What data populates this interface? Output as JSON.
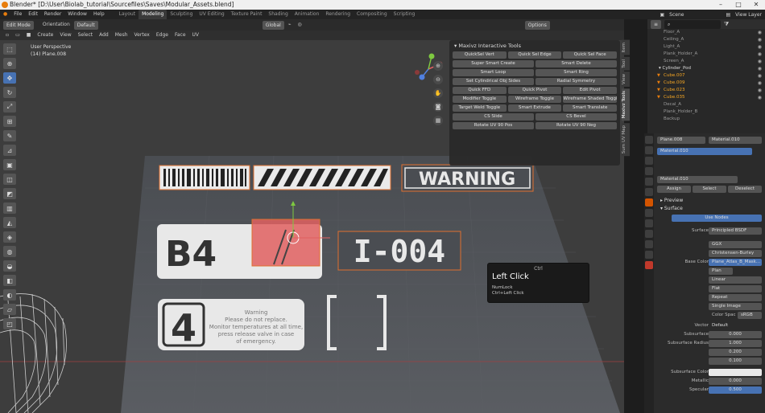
{
  "titlebar": {
    "title": "Blender* [D:\\User\\Biolab_tutorial\\Sourcefiles\\Saves\\Modular_Assets.blend]"
  },
  "menu": [
    "File",
    "Edit",
    "Render",
    "Window",
    "Help"
  ],
  "workspaces": [
    "Layout",
    "Modeling",
    "Sculpting",
    "UV Editing",
    "Texture Paint",
    "Shading",
    "Animation",
    "Rendering",
    "Compositing",
    "Scripting"
  ],
  "top_right": {
    "scene": "Scene",
    "view_layer": "View Layer"
  },
  "viewport_header": {
    "mode": "Edit Mode",
    "orientation": "Orientation",
    "orientation_value": "Default",
    "transform_space": "Global",
    "options": "Options",
    "menus": [
      "View",
      "Select",
      "Add",
      "Mesh",
      "Vertex",
      "Edge",
      "Face",
      "UV"
    ],
    "create": "Create"
  },
  "viewport_info": {
    "perspective": "User Perspective",
    "object": "(14) Plane.008"
  },
  "tools_panel": {
    "title": "Maxivz Interactive Tools",
    "rows": [
      [
        "QuickSel Vert",
        "Quick Sel Edge",
        "Quick Sel Face"
      ],
      [
        "Super Smart Create",
        "Smart Delete"
      ],
      [
        "Smart Loop",
        "Smart Ring"
      ],
      [
        "Set Cylindrical Obj Sides",
        "Radial Symmetry"
      ],
      [
        "Quick FFD",
        "Quick Pivot",
        "Edit Pivot"
      ],
      [
        "Modifier Toggle",
        "Wireframe Toggle",
        "Wireframe Shaded Toggle"
      ],
      [
        "Target Weld Toggle",
        "Smart Extrude",
        "Smart Translate"
      ],
      [
        "CS Slide",
        "CS Bevel"
      ],
      [
        "Rotate UV 90 Pos",
        "Rotate UV 90 Neg"
      ]
    ]
  },
  "side_tabs": [
    "Item",
    "Tool",
    "View",
    "Maxivz Tools",
    "Sum UV Map"
  ],
  "scene_labels": {
    "warning": "WARNING",
    "b4": "B4",
    "id_code": "I-004",
    "number": "4",
    "warning_text": "Warning\nPlease do not replace. Monitor temperatures at all time, press release valve in case of emergency.",
    "brackets": "[   ]"
  },
  "tooltip": {
    "key": "Ctrl",
    "action": "Left Click",
    "line1": "NumLock",
    "line2": "Ctrl+Left Click"
  },
  "outliner": {
    "items": [
      {
        "name": "Floor_A",
        "type": "obj"
      },
      {
        "name": "Ceiling_A",
        "type": "obj"
      },
      {
        "name": "Light_A",
        "type": "obj"
      },
      {
        "name": "Plank_Holder_A",
        "type": "obj"
      },
      {
        "name": "Screen_A",
        "type": "obj"
      },
      {
        "name": "Cylinder_Pod",
        "type": "collection"
      },
      {
        "name": "Cube.007",
        "type": "sel"
      },
      {
        "name": "Cube.009",
        "type": "sel"
      },
      {
        "name": "Cube.023",
        "type": "sel"
      },
      {
        "name": "Cube.035",
        "type": "sel"
      },
      {
        "name": "Decal_A",
        "type": "obj"
      },
      {
        "name": "Plank_Holder_B",
        "type": "obj"
      },
      {
        "name": "Backup",
        "type": "obj"
      }
    ]
  },
  "properties": {
    "object": "Plane.008",
    "material_tab": "Material.010",
    "slot": "Material.010",
    "material_name": "Material.010",
    "buttons": [
      "Assign",
      "Select",
      "Deselect"
    ],
    "sections": {
      "preview": "Preview",
      "surface": "Surface"
    },
    "use_nodes": "Use Nodes",
    "surface_label": "Surface",
    "surface_value": "Principled BSDF",
    "ggx": "GGX",
    "christensen": "Christensen-Burley",
    "base_color_label": "Base Color",
    "base_color_value": "Plane_Atlas_B_Mask...",
    "image_name": "Plan",
    "interp": "Linear",
    "projection": "Flat",
    "extension": "Repeat",
    "source": "Single Image",
    "color_space_label": "Color Spac",
    "color_space_value": "sRGB",
    "vector_label": "Vector",
    "vector_value": "Default",
    "subsurface_label": "Subsurface",
    "subsurface_value": "0.000",
    "radius_label": "Subsurface Radius",
    "radius_values": [
      "1.000",
      "0.200",
      "0.100"
    ],
    "ss_color_label": "Subsurface Color",
    "metallic_label": "Metallic",
    "metallic_value": "0.000",
    "specular_label": "Specular",
    "specular_value": "0.500"
  },
  "colors": {
    "accent": "#4772b3",
    "selection": "#f5a623",
    "red_face": "#e06060"
  }
}
